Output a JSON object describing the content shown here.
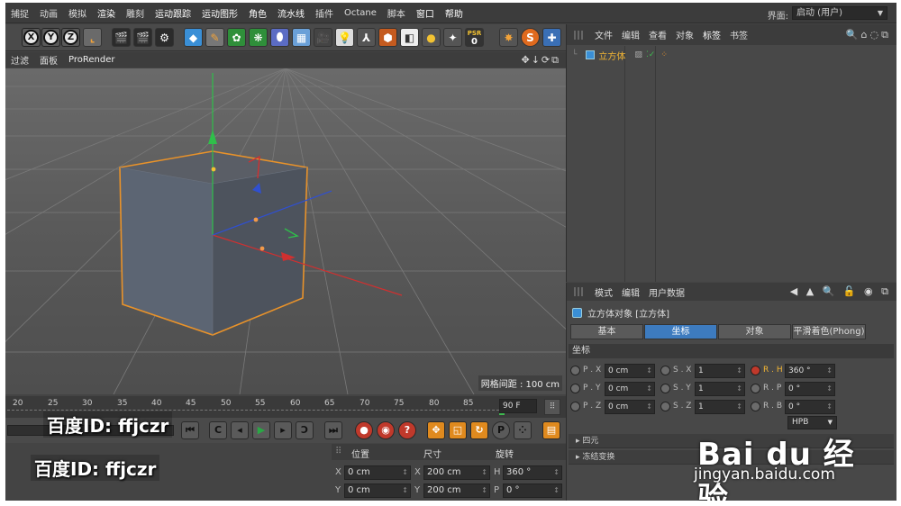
{
  "menubar": {
    "items": [
      "捕捉",
      "动画",
      "模拟",
      "渲染",
      "雕刻",
      "运动跟踪",
      "运动图形",
      "角色",
      "流水线",
      "插件",
      "Octane",
      "脚本",
      "窗口",
      "帮助"
    ],
    "layout_label": "界面:",
    "layout_value": "启动 (用户)"
  },
  "toolbar": {
    "axis_x": "X",
    "axis_y": "Y",
    "axis_z": "Z",
    "psr_label": "PSR",
    "psr_value": "0",
    "icons": [
      "coordinate-system-icon",
      "render-region-icon",
      "render-to-picture-viewer-icon",
      "render-settings-icon",
      "cube-icon",
      "pen-icon",
      "subdivision-icon",
      "cloner-icon",
      "deformer-icon",
      "floor-icon",
      "camera-icon",
      "light-icon",
      "bone-icon",
      "material-icon",
      "texture-icon",
      "sun-icon",
      "sky-icon",
      "psr-icon",
      "explode-icon",
      "snap-icon",
      "script-icon"
    ]
  },
  "viewport": {
    "menu": [
      "过滤",
      "面板",
      "ProRender"
    ],
    "grid_label": "网格间距 : 100 cm",
    "accent": "#e8922a"
  },
  "timeline": {
    "ticks": [
      "20",
      "25",
      "30",
      "35",
      "40",
      "45",
      "50",
      "55",
      "60",
      "65",
      "70",
      "75",
      "80",
      "85"
    ],
    "frame": "90 F",
    "end_btn": "0"
  },
  "watermark": {
    "text1": "百度ID: ffjczr",
    "text2": "百度ID: ffjczr"
  },
  "coords": {
    "col_pos": "位置",
    "col_size": "尺寸",
    "col_rot": "旋转",
    "rows": [
      {
        "axis": "X",
        "pos": "0 cm",
        "size_axis": "X",
        "size": "200 cm",
        "rot_axis": "H",
        "rot": "360 °"
      },
      {
        "axis": "Y",
        "pos": "0 cm",
        "size_axis": "Y",
        "size": "200 cm",
        "rot_axis": "P",
        "rot": "0 °"
      }
    ]
  },
  "objmgr": {
    "menu": [
      "文件",
      "编辑",
      "查看",
      "对象",
      "标签",
      "书签"
    ],
    "active_menu": "标签",
    "object_name": "立方体"
  },
  "attrmgr": {
    "menu": [
      "模式",
      "编辑",
      "用户数据"
    ],
    "title": "立方体对象 [立方体]",
    "tabs": [
      "基本",
      "坐标",
      "对象",
      "平滑着色(Phong)"
    ],
    "active_tab": "坐标",
    "section": "坐标",
    "rows": [
      [
        {
          "label": "P . X",
          "value": "0 cm"
        },
        {
          "label": "S . X",
          "value": "1"
        },
        {
          "label": "R . H",
          "value": "360 °"
        }
      ],
      [
        {
          "label": "P . Y",
          "value": "0 cm"
        },
        {
          "label": "S . Y",
          "value": "1"
        },
        {
          "label": "R . P",
          "value": "0 °"
        }
      ],
      [
        {
          "label": "P . Z",
          "value": "0 cm"
        },
        {
          "label": "S . Z",
          "value": "1"
        },
        {
          "label": "R . B",
          "value": "0 °"
        }
      ]
    ],
    "order": "HPB",
    "group1": "▸ 四元",
    "group2": "▸ 冻结变换"
  },
  "baidu": {
    "logo": "Bai du 经验",
    "url": "jingyan.baidu.com"
  }
}
